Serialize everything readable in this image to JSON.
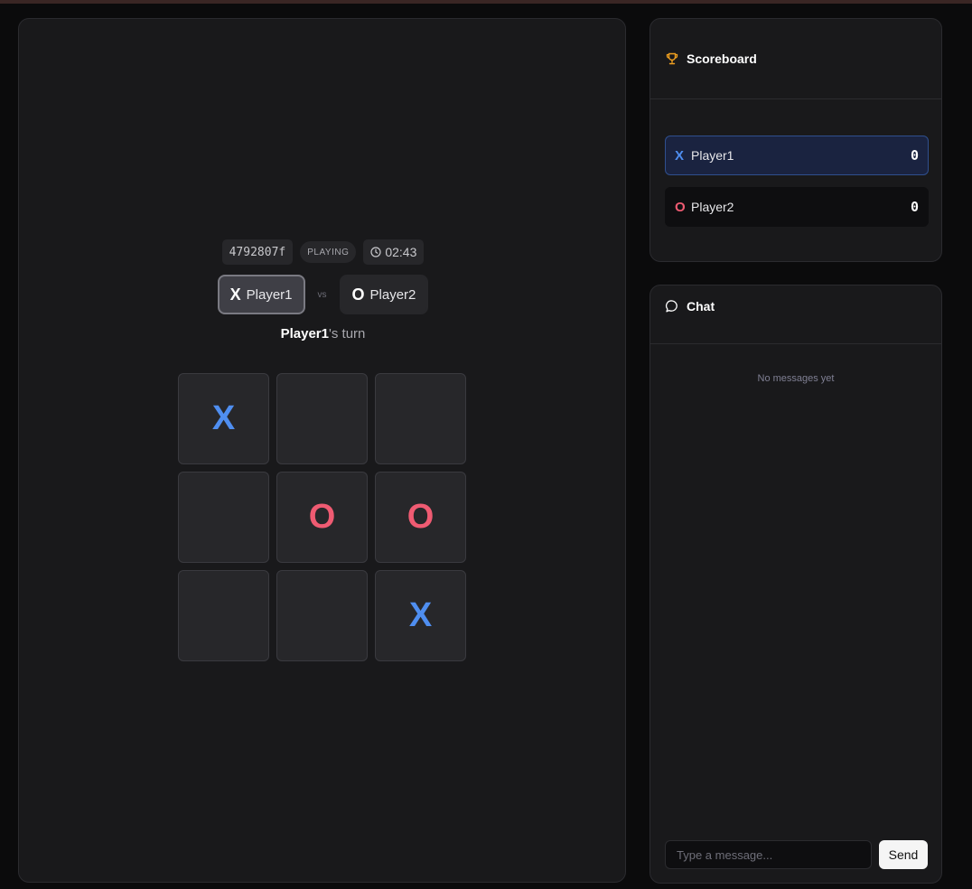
{
  "game": {
    "id": "4792807f",
    "status": "PLAYING",
    "timer": "02:43",
    "player_x": {
      "mark": "X",
      "name": "Player1"
    },
    "player_o": {
      "mark": "O",
      "name": "Player2"
    },
    "vs_label": "vs",
    "turn_player": "Player1",
    "turn_suffix": "'s turn",
    "board": [
      "X",
      "",
      "",
      "",
      "O",
      "O",
      "",
      "",
      "X"
    ]
  },
  "scoreboard": {
    "title": "Scoreboard",
    "rows": [
      {
        "mark": "X",
        "name": "Player1",
        "score": "0"
      },
      {
        "mark": "O",
        "name": "Player2",
        "score": "0"
      }
    ]
  },
  "chat": {
    "title": "Chat",
    "empty_text": "No messages yet",
    "input_placeholder": "Type a message...",
    "send_label": "Send"
  },
  "colors": {
    "x_mark": "#4f8ef0",
    "o_mark": "#ef5b72",
    "panel_bg": "#19191b",
    "page_bg": "#0b0b0c",
    "active_row_bg": "#1a2340"
  },
  "icons": {
    "scoreboard": "trophy-icon",
    "chat": "chat-bubble-icon",
    "timer": "clock-icon"
  }
}
